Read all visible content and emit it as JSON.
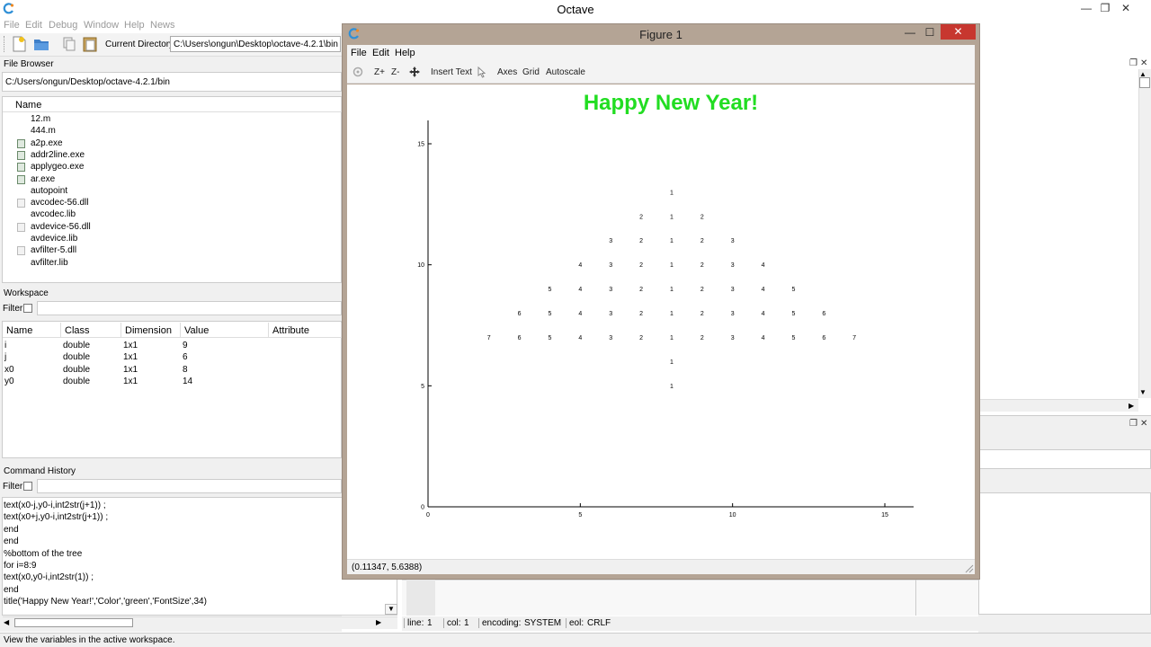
{
  "app": {
    "title": "Octave"
  },
  "menubar": [
    "File",
    "Edit",
    "Debug",
    "Window",
    "Help",
    "News"
  ],
  "toolbar": {
    "current_directory_label": "Current Directory:",
    "current_directory_value": "C:\\Users\\ongun\\Desktop\\octave-4.2.1\\bin"
  },
  "file_browser": {
    "title": "File Browser",
    "path": "C:/Users/ongun/Desktop/octave-4.2.1/bin",
    "column_header": "Name",
    "files": [
      {
        "name": "12.m",
        "icon": "blank-file-icon"
      },
      {
        "name": "444.m",
        "icon": "blank-file-icon"
      },
      {
        "name": "a2p.exe",
        "icon": "exe-file-icon"
      },
      {
        "name": "addr2line.exe",
        "icon": "exe-file-icon"
      },
      {
        "name": "applygeo.exe",
        "icon": "exe-file-icon"
      },
      {
        "name": "ar.exe",
        "icon": "exe-file-icon"
      },
      {
        "name": "autopoint",
        "icon": "blank-file-icon"
      },
      {
        "name": "avcodec-56.dll",
        "icon": "dll-file-icon"
      },
      {
        "name": "avcodec.lib",
        "icon": "blank-file-icon"
      },
      {
        "name": "avdevice-56.dll",
        "icon": "dll-file-icon"
      },
      {
        "name": "avdevice.lib",
        "icon": "blank-file-icon"
      },
      {
        "name": "avfilter-5.dll",
        "icon": "dll-file-icon"
      },
      {
        "name": "avfilter.lib",
        "icon": "blank-file-icon"
      }
    ]
  },
  "workspace": {
    "title": "Workspace",
    "filter_label": "Filter",
    "columns": [
      "Name",
      "Class",
      "Dimension",
      "Value",
      "Attribute"
    ],
    "rows": [
      [
        "i",
        "double",
        "1x1",
        "9",
        ""
      ],
      [
        "j",
        "double",
        "1x1",
        "6",
        ""
      ],
      [
        "x0",
        "double",
        "1x1",
        "8",
        ""
      ],
      [
        "y0",
        "double",
        "1x1",
        "14",
        ""
      ]
    ]
  },
  "command_history": {
    "title": "Command History",
    "filter_label": "Filter",
    "lines": [
      "text(x0-j,y0-i,int2str(j+1)) ;",
      "text(x0+j,y0-i,int2str(j+1)) ;",
      "end",
      "end",
      "%bottom of the tree",
      "for i=8:9",
      "text(x0,y0-i,int2str(1)) ;",
      "end",
      "title('Happy New Year!','Color','green','FontSize',34)"
    ]
  },
  "figure": {
    "window_title": "Figure 1",
    "menu": [
      "File",
      "Edit",
      "Help"
    ],
    "toolbar": {
      "zoom_in": "Z+",
      "zoom_out": "Z-",
      "insert_text": "Insert Text",
      "axes": "Axes",
      "grid": "Grid",
      "autoscale": "Autoscale"
    },
    "coords": "(0.11347, 5.6388)",
    "title_color": "#22dd22"
  },
  "chart_data": {
    "type": "scatter",
    "title": "Happy New Year!",
    "xlim": [
      0,
      16
    ],
    "ylim": [
      0,
      16
    ],
    "xticks": [
      0,
      5,
      10,
      15
    ],
    "yticks": [
      0,
      5,
      10,
      15
    ],
    "grid": false,
    "points": [
      {
        "x": 8,
        "y": 13,
        "label": "1"
      },
      {
        "x": 7,
        "y": 12,
        "label": "2"
      },
      {
        "x": 8,
        "y": 12,
        "label": "1"
      },
      {
        "x": 9,
        "y": 12,
        "label": "2"
      },
      {
        "x": 6,
        "y": 11,
        "label": "3"
      },
      {
        "x": 7,
        "y": 11,
        "label": "2"
      },
      {
        "x": 8,
        "y": 11,
        "label": "1"
      },
      {
        "x": 9,
        "y": 11,
        "label": "2"
      },
      {
        "x": 10,
        "y": 11,
        "label": "3"
      },
      {
        "x": 5,
        "y": 10,
        "label": "4"
      },
      {
        "x": 6,
        "y": 10,
        "label": "3"
      },
      {
        "x": 7,
        "y": 10,
        "label": "2"
      },
      {
        "x": 8,
        "y": 10,
        "label": "1"
      },
      {
        "x": 9,
        "y": 10,
        "label": "2"
      },
      {
        "x": 10,
        "y": 10,
        "label": "3"
      },
      {
        "x": 11,
        "y": 10,
        "label": "4"
      },
      {
        "x": 4,
        "y": 9,
        "label": "5"
      },
      {
        "x": 5,
        "y": 9,
        "label": "4"
      },
      {
        "x": 6,
        "y": 9,
        "label": "3"
      },
      {
        "x": 7,
        "y": 9,
        "label": "2"
      },
      {
        "x": 8,
        "y": 9,
        "label": "1"
      },
      {
        "x": 9,
        "y": 9,
        "label": "2"
      },
      {
        "x": 10,
        "y": 9,
        "label": "3"
      },
      {
        "x": 11,
        "y": 9,
        "label": "4"
      },
      {
        "x": 12,
        "y": 9,
        "label": "5"
      },
      {
        "x": 3,
        "y": 8,
        "label": "6"
      },
      {
        "x": 4,
        "y": 8,
        "label": "5"
      },
      {
        "x": 5,
        "y": 8,
        "label": "4"
      },
      {
        "x": 6,
        "y": 8,
        "label": "3"
      },
      {
        "x": 7,
        "y": 8,
        "label": "2"
      },
      {
        "x": 8,
        "y": 8,
        "label": "1"
      },
      {
        "x": 9,
        "y": 8,
        "label": "2"
      },
      {
        "x": 10,
        "y": 8,
        "label": "3"
      },
      {
        "x": 11,
        "y": 8,
        "label": "4"
      },
      {
        "x": 12,
        "y": 8,
        "label": "5"
      },
      {
        "x": 13,
        "y": 8,
        "label": "6"
      },
      {
        "x": 2,
        "y": 7,
        "label": "7"
      },
      {
        "x": 3,
        "y": 7,
        "label": "6"
      },
      {
        "x": 4,
        "y": 7,
        "label": "5"
      },
      {
        "x": 5,
        "y": 7,
        "label": "4"
      },
      {
        "x": 6,
        "y": 7,
        "label": "3"
      },
      {
        "x": 7,
        "y": 7,
        "label": "2"
      },
      {
        "x": 8,
        "y": 7,
        "label": "1"
      },
      {
        "x": 9,
        "y": 7,
        "label": "2"
      },
      {
        "x": 10,
        "y": 7,
        "label": "3"
      },
      {
        "x": 11,
        "y": 7,
        "label": "4"
      },
      {
        "x": 12,
        "y": 7,
        "label": "5"
      },
      {
        "x": 13,
        "y": 7,
        "label": "6"
      },
      {
        "x": 14,
        "y": 7,
        "label": "7"
      },
      {
        "x": 8,
        "y": 6,
        "label": "1"
      },
      {
        "x": 8,
        "y": 5,
        "label": "1"
      }
    ]
  },
  "editor_status": {
    "line_label": "line:",
    "line_value": "1",
    "col_label": "col:",
    "col_value": "1",
    "encoding_label": "encoding:",
    "encoding_value": "SYSTEM",
    "eol_label": "eol:",
    "eol_value": "CRLF"
  },
  "statusbar": {
    "text": "View the variables in the active workspace."
  }
}
